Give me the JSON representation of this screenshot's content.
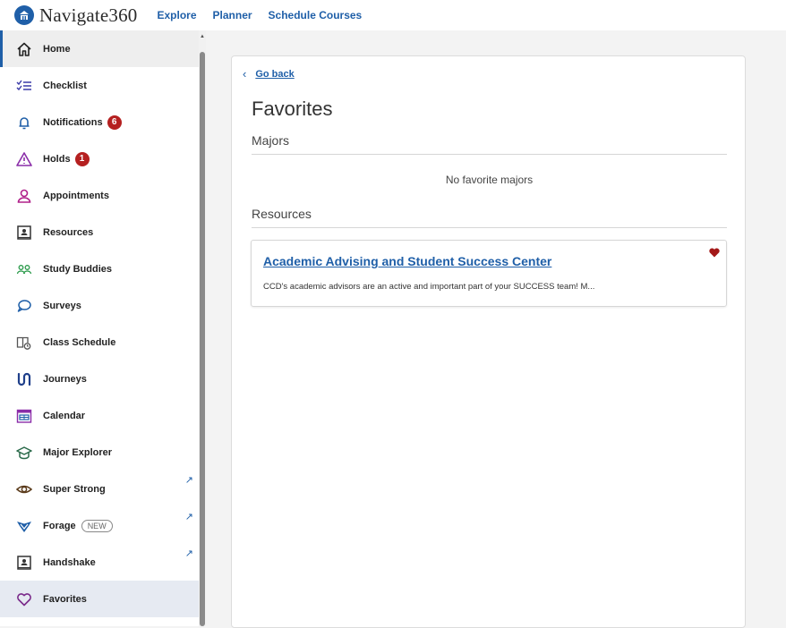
{
  "app": {
    "name": "Navigate360"
  },
  "topnav": [
    {
      "label": "Explore"
    },
    {
      "label": "Planner"
    },
    {
      "label": "Schedule Courses"
    }
  ],
  "sidebar": {
    "items": [
      {
        "label": "Home",
        "icon": "home-icon"
      },
      {
        "label": "Checklist",
        "icon": "checklist-icon"
      },
      {
        "label": "Notifications",
        "icon": "bell-icon",
        "badge": "6"
      },
      {
        "label": "Holds",
        "icon": "warning-icon",
        "badge": "1"
      },
      {
        "label": "Appointments",
        "icon": "person-icon"
      },
      {
        "label": "Resources",
        "icon": "resources-icon"
      },
      {
        "label": "Study Buddies",
        "icon": "people-icon"
      },
      {
        "label": "Surveys",
        "icon": "chat-bubble-icon"
      },
      {
        "label": "Class Schedule",
        "icon": "class-schedule-icon"
      },
      {
        "label": "Journeys",
        "icon": "journeys-icon"
      },
      {
        "label": "Calendar",
        "icon": "calendar-icon"
      },
      {
        "label": "Major Explorer",
        "icon": "graduation-cap-icon"
      },
      {
        "label": "Super Strong",
        "icon": "eye-icon"
      },
      {
        "label": "Forage",
        "icon": "forage-logo-icon",
        "pill": "NEW"
      },
      {
        "label": "Handshake",
        "icon": "handshake-icon"
      },
      {
        "label": "Favorites",
        "icon": "heart-outline-icon"
      }
    ]
  },
  "main": {
    "go_back": "Go back",
    "title": "Favorites",
    "majors_heading": "Majors",
    "majors_empty": "No favorite majors",
    "resources_heading": "Resources",
    "resources": [
      {
        "title": "Academic Advising and Student Success Center",
        "description": "CCD's academic advisors are an active and important part of your SUCCESS team! M..."
      }
    ]
  },
  "colors": {
    "accent": "#1f5fa8",
    "badge": "#b52020",
    "heart": "#a31818",
    "active_bg": "#e6eaf2"
  }
}
